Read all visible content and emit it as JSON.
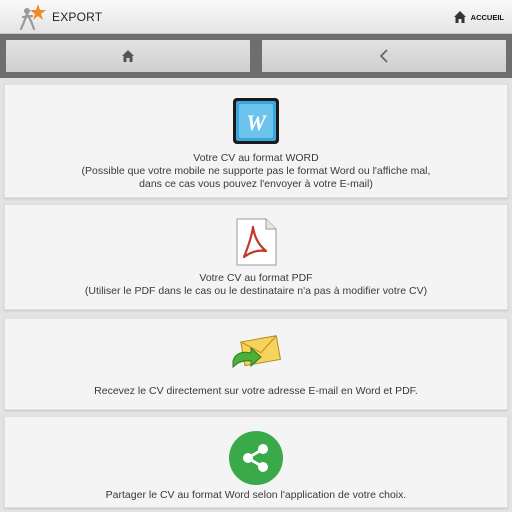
{
  "header": {
    "title": "EXPORT",
    "home_label": "ACCUEIL",
    "logo_icon": "person-star-logo-icon",
    "home_icon": "house-icon"
  },
  "nav": {
    "home_icon": "house-icon",
    "back_icon": "chevron-left-icon"
  },
  "cards": [
    {
      "icon": "word-document-icon",
      "line1": "Votre CV au format WORD",
      "line2": "(Possible que votre mobile ne supporte pas le format Word ou l'affiche mal,",
      "line3": "dans ce cas vous pouvez l'envoyer à votre E-mail)"
    },
    {
      "icon": "pdf-document-icon",
      "line1": "Votre CV au format PDF",
      "line2": "(Utiliser le PDF dans le cas ou le destinataire n'a pas à modifier votre CV)"
    },
    {
      "icon": "email-envelope-icon",
      "line1": "Recevez le CV directement sur votre adresse E-mail en Word et PDF."
    },
    {
      "icon": "share-icon",
      "line1": "Partager le CV au format Word selon l'application de votre choix."
    }
  ],
  "colors": {
    "share_green": "#3aa94a",
    "word_blue": "#1f8fc8",
    "pdf_red": "#c0392b",
    "envelope_yellow": "#f3c94a"
  }
}
